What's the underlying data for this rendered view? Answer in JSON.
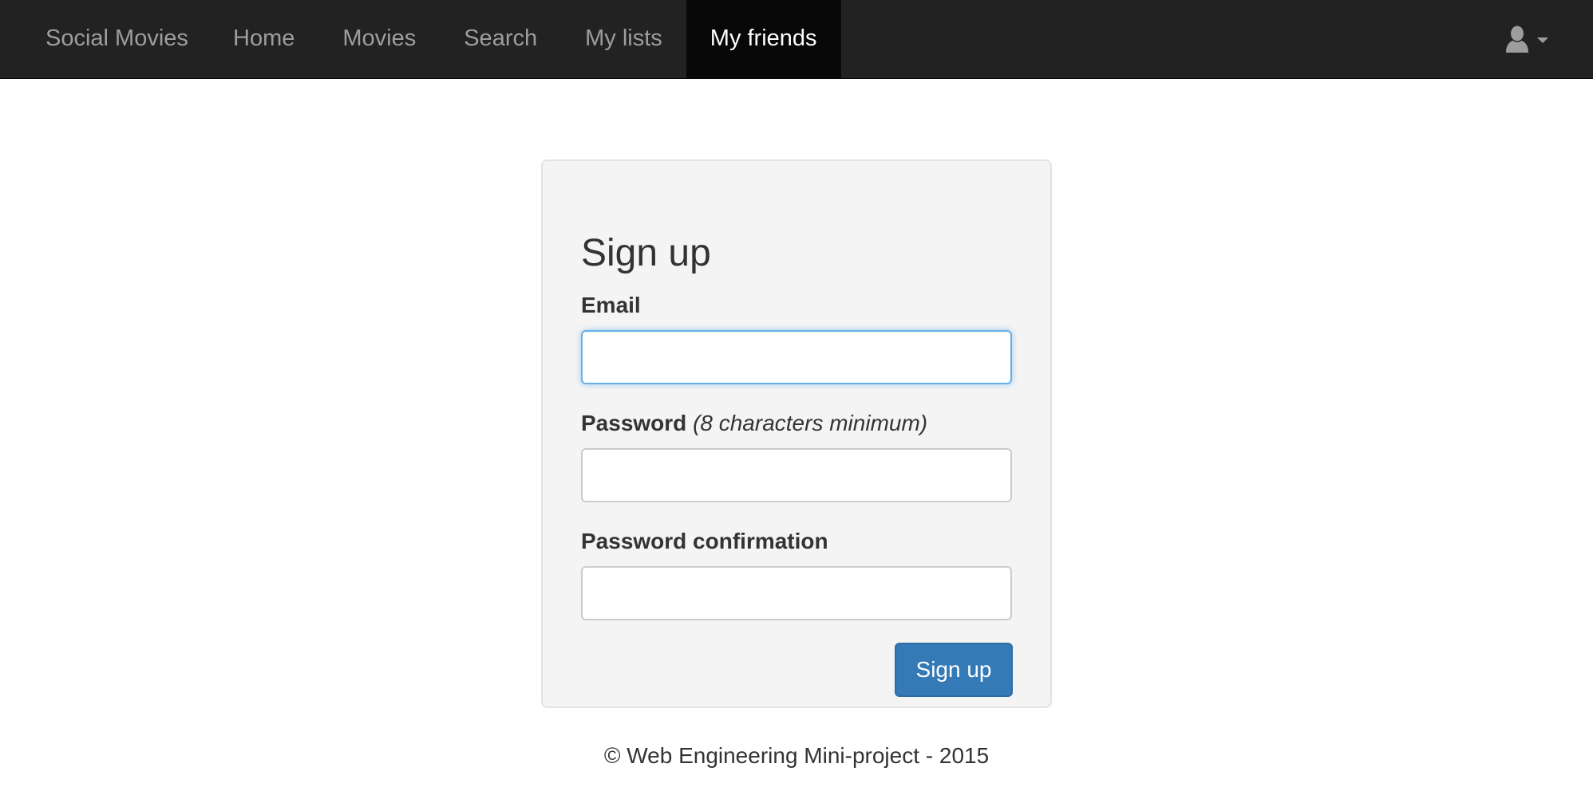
{
  "navbar": {
    "brand": "Social Movies",
    "items": [
      {
        "label": "Home",
        "active": false
      },
      {
        "label": "Movies",
        "active": false
      },
      {
        "label": "Search",
        "active": false
      },
      {
        "label": "My lists",
        "active": false
      },
      {
        "label": "My friends",
        "active": true
      }
    ],
    "user_icon": "user-icon",
    "dropdown_icon": "caret-down-icon"
  },
  "form": {
    "title": "Sign up",
    "email": {
      "label": "Email",
      "value": "",
      "placeholder": ""
    },
    "password": {
      "label": "Password",
      "hint": "(8 characters minimum)",
      "value": "",
      "placeholder": ""
    },
    "password_confirmation": {
      "label": "Password confirmation",
      "value": "",
      "placeholder": ""
    },
    "submit_label": "Sign up"
  },
  "footer": {
    "text": "© Web Engineering Mini-project - 2015"
  },
  "colors": {
    "navbar_bg": "#222222",
    "navbar_active_bg": "#080808",
    "nav_text": "#9d9d9d",
    "nav_active_text": "#ffffff",
    "card_bg": "#f4f4f4",
    "primary_button": "#337ab7",
    "focus_border": "#66afe9"
  }
}
